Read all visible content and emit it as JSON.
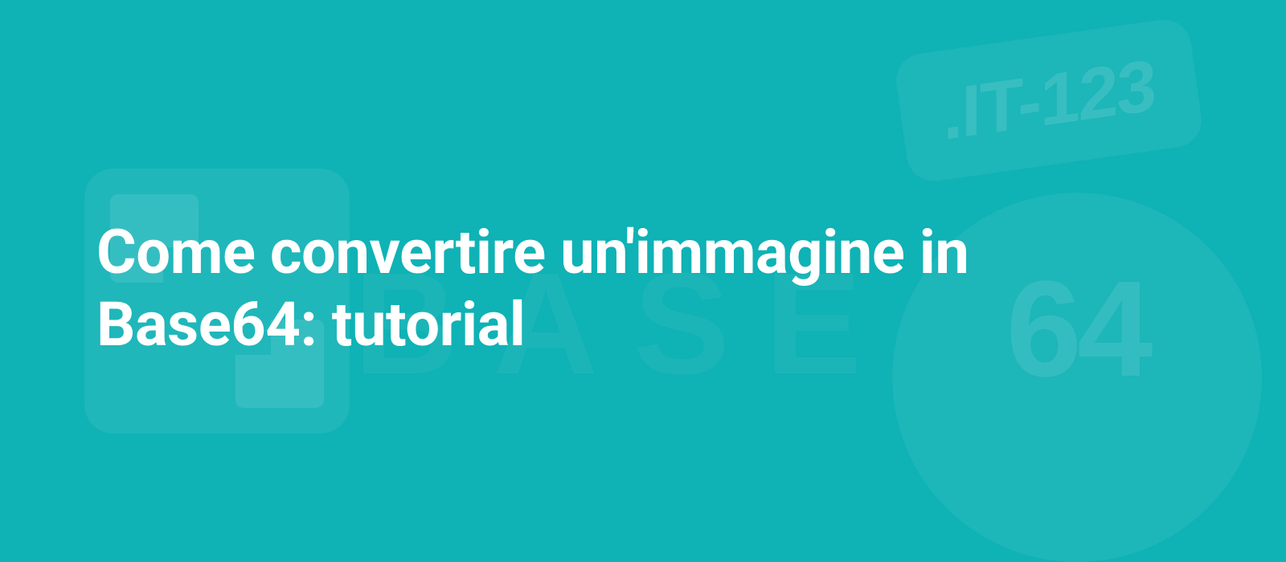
{
  "title": "Come convertire un'immagine in Base64: tutorial",
  "background": {
    "badge_text": ".IT-123",
    "circle_text": "64",
    "watermark_text": "BASE"
  },
  "colors": {
    "bg": "#0fb2b5",
    "text": "#ffffff"
  }
}
